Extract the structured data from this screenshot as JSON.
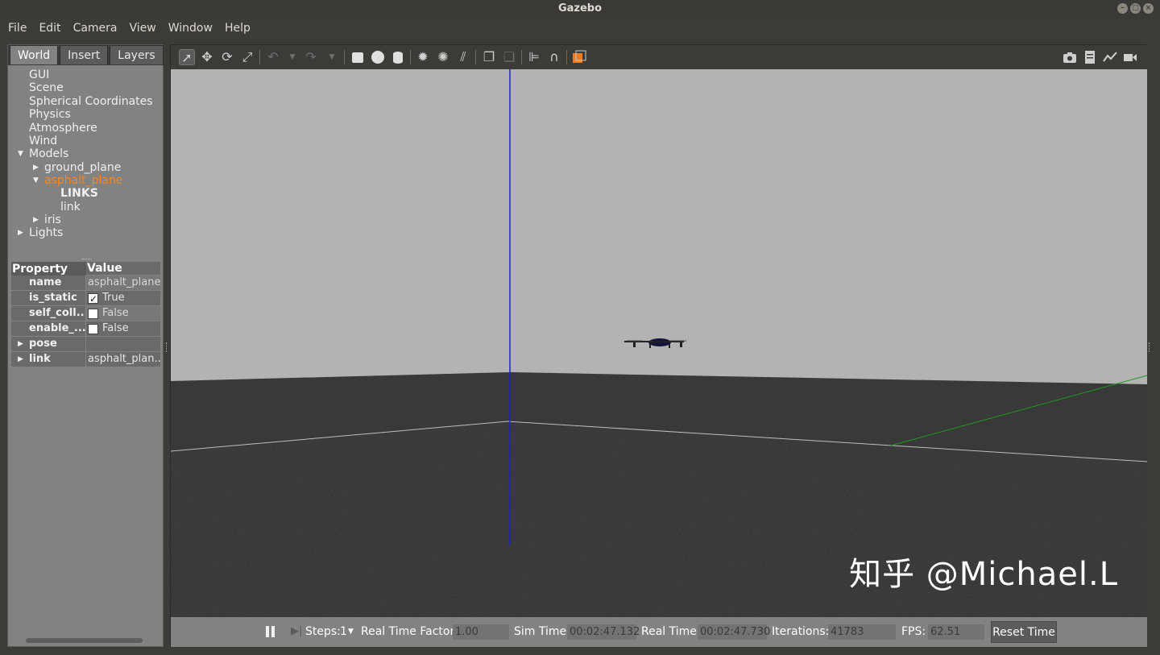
{
  "window": {
    "title": "Gazebo",
    "buttons": [
      "–",
      "□",
      "×"
    ]
  },
  "menu": [
    "File",
    "Edit",
    "Camera",
    "View",
    "Window",
    "Help"
  ],
  "left_tabs": [
    "World",
    "Insert",
    "Layers"
  ],
  "tree": {
    "items": [
      "GUI",
      "Scene",
      "Spherical Coordinates",
      "Physics",
      "Atmosphere",
      "Wind",
      "Models"
    ],
    "models": [
      "ground_plane",
      "asphalt_plane",
      "iris"
    ],
    "links_header": "LINKS",
    "link": "link",
    "lights": "Lights"
  },
  "properties": {
    "headers": [
      "Property",
      "Value"
    ],
    "rows": [
      {
        "key": "name",
        "value": "asphalt_plane"
      },
      {
        "key": "is_static",
        "value": "True",
        "checked": true
      },
      {
        "key": "self_coll...",
        "value": "False",
        "checked": false
      },
      {
        "key": "enable_...",
        "value": "False",
        "checked": false
      },
      {
        "key": "pose",
        "value": ""
      },
      {
        "key": "link",
        "value": "asphalt_plan..."
      }
    ]
  },
  "toolbar": {
    "tools": [
      "select-arrow",
      "translate",
      "rotate",
      "scale",
      "undo",
      "redo",
      "box",
      "sphere",
      "cylinder",
      "point-light",
      "spot-light",
      "directional-light",
      "copy",
      "paste",
      "align",
      "snap",
      "view-angle"
    ],
    "right_tools": [
      "screenshot",
      "log",
      "plot",
      "video"
    ]
  },
  "bottom": {
    "steps_label": "Steps:",
    "steps_value": "1",
    "rtf_label": "Real Time Factor:",
    "rtf_value": "1.00",
    "sim_label": "Sim Time:",
    "sim_value": "00:02:47.132",
    "real_label": "Real Time:",
    "real_value": "00:02:47.730",
    "iter_label": "Iterations:",
    "iter_value": "41783",
    "fps_label": "FPS:",
    "fps_value": "62.51",
    "reset_label": "Reset Time"
  },
  "watermark": "知乎 @Michael.L",
  "colors": {
    "selected": "#f5871f",
    "sky": "#b3b3b3",
    "wall": "#393939",
    "ground": "#2a2a2a",
    "z_axis": "#2020d0",
    "y_axis": "#1f9a1f"
  }
}
